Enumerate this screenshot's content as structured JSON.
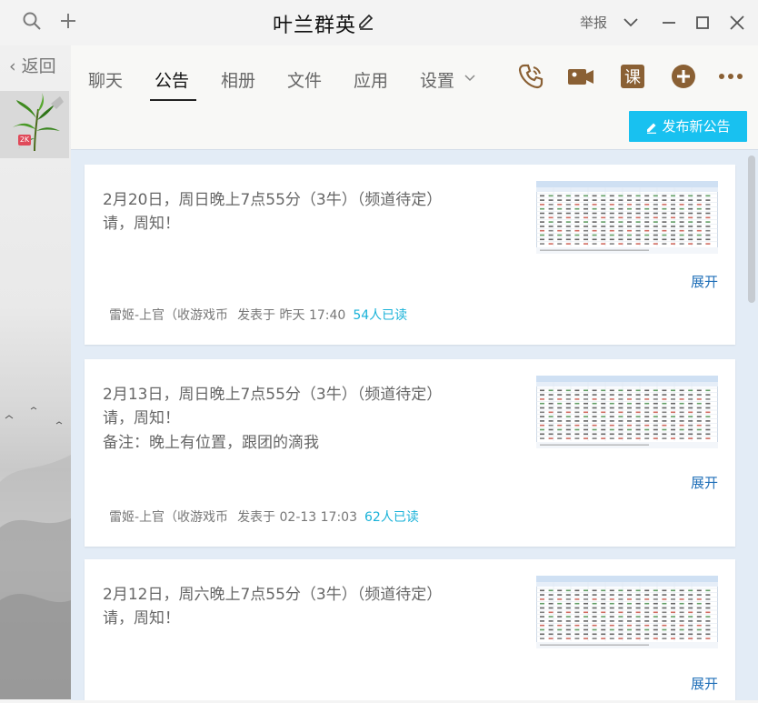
{
  "window": {
    "title": "叶兰群英",
    "report_label": "举报",
    "icons": [
      "search-icon",
      "plus-icon",
      "edit-icon",
      "chevron-down-icon",
      "minimize-icon",
      "maximize-icon",
      "close-icon"
    ]
  },
  "sidebar": {
    "back_label": "返回",
    "avatar_badge": "2K"
  },
  "tabs": [
    {
      "label": "聊天",
      "active": false
    },
    {
      "label": "公告",
      "active": true
    },
    {
      "label": "相册",
      "active": false
    },
    {
      "label": "文件",
      "active": false
    },
    {
      "label": "应用",
      "active": false
    },
    {
      "label": "设置",
      "active": false
    }
  ],
  "actions": {
    "course_label": "课",
    "icons": [
      "phone-icon",
      "video-icon",
      "course-icon",
      "add-icon",
      "more-icon"
    ],
    "icon_color": "#8a6034"
  },
  "toolbar": {
    "publish_label": "发布新公告",
    "publish_color": "#18c1f0"
  },
  "announcements": [
    {
      "lines": [
        "2月20日，周日晚上7点55分（3牛）（频道待定）",
        "请，周知！"
      ],
      "expand_label": "展开",
      "author": "雷姬-上官（收游戏币",
      "posted": "发表于 昨天 17:40",
      "read": "54人已读"
    },
    {
      "lines": [
        "2月13日，周日晚上7点55分（3牛）（频道待定）",
        "请，周知！",
        "备注：晚上有位置，跟团的滴我"
      ],
      "expand_label": "展开",
      "author": "雷姬-上官（收游戏币",
      "posted": "发表于 02-13 17:03",
      "read": "62人已读"
    },
    {
      "lines": [
        "2月12日，周六晚上7点55分（3牛）（频道待定）",
        "请，周知！"
      ],
      "expand_label": "展开",
      "author": "",
      "posted": "",
      "read": ""
    }
  ]
}
